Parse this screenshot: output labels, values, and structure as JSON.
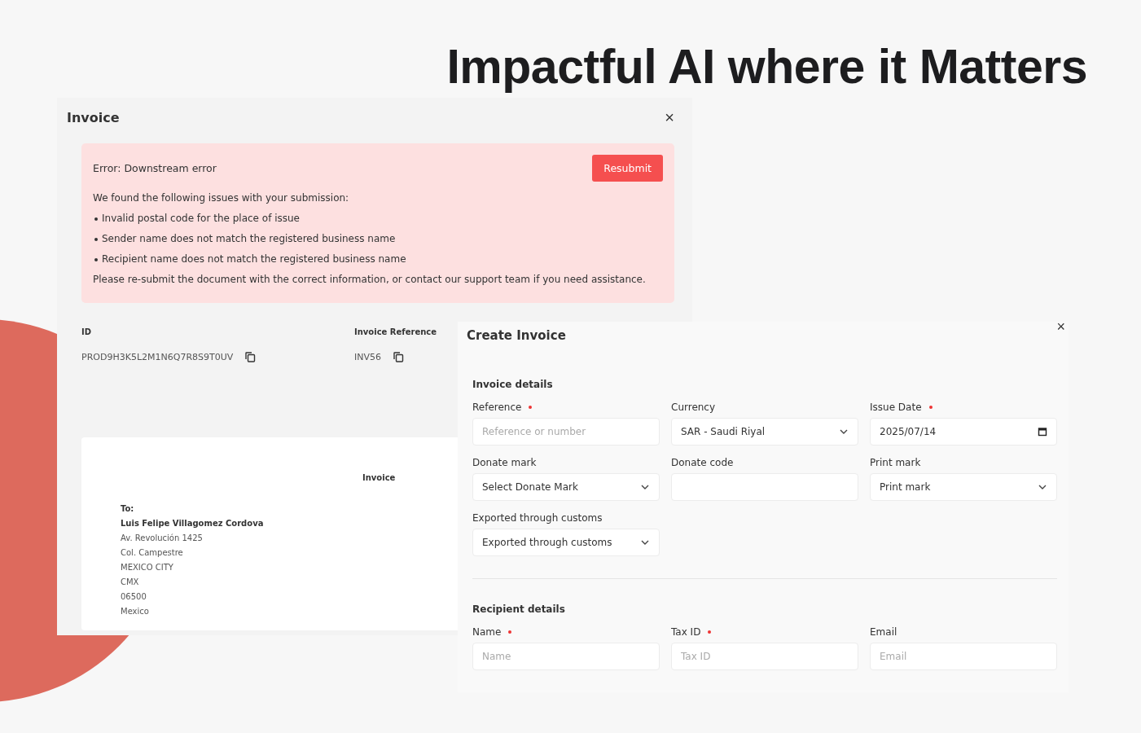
{
  "headline": "Impactful AI where it Matters",
  "invoice_dialog": {
    "title": "Invoice",
    "close": "×",
    "error": {
      "title": "Error: Downstream error",
      "button": "Resubmit",
      "intro": "We found the following issues with your submission:",
      "issues": [
        "Invalid postal code for the place of issue",
        "Sender name does not match the registered business name",
        "Recipient name does not match the registered business name"
      ],
      "footer": "Please re-submit the document with the correct information, or contact our support team if you need assistance."
    },
    "fields": [
      {
        "label": "ID",
        "value": "PROD9H3K5L2M1N6Q7R8S9T0UV"
      },
      {
        "label": "Invoice Reference",
        "value": "INV56"
      }
    ],
    "document": {
      "title": "Invoice",
      "to_label": "To:",
      "recipient_name": "Luis Felipe Villagomez Cordova",
      "address_lines": [
        "Av. Revolución 1425",
        "Col. Campestre",
        "MEXICO CITY",
        "CMX",
        "06500",
        "Mexico"
      ]
    }
  },
  "create_dialog": {
    "title": "Create Invoice",
    "close": "×",
    "sections": [
      {
        "title": "Invoice details",
        "fields": [
          {
            "label": "Reference",
            "required": true,
            "kind": "text",
            "placeholder": "Reference or number"
          },
          {
            "label": "Currency",
            "required": false,
            "kind": "select",
            "value": "SAR - Saudi Riyal"
          },
          {
            "label": "Issue Date",
            "required": true,
            "kind": "date",
            "value": "2025/07/14"
          },
          {
            "label": "Donate mark",
            "required": false,
            "kind": "select",
            "value": "Select Donate Mark"
          },
          {
            "label": "Donate code",
            "required": false,
            "kind": "text"
          },
          {
            "label": "Print mark",
            "required": false,
            "kind": "select",
            "value": "Print mark"
          },
          {
            "label": "Exported through customs",
            "required": false,
            "kind": "select",
            "value": "Exported through customs"
          }
        ]
      },
      {
        "title": "Recipient details",
        "fields": [
          {
            "label": "Name",
            "required": true,
            "kind": "text",
            "placeholder": "Name"
          },
          {
            "label": "Tax ID",
            "required": true,
            "kind": "text",
            "placeholder": "Tax ID"
          },
          {
            "label": "Email",
            "required": false,
            "kind": "text",
            "placeholder": "Email"
          }
        ]
      }
    ]
  }
}
